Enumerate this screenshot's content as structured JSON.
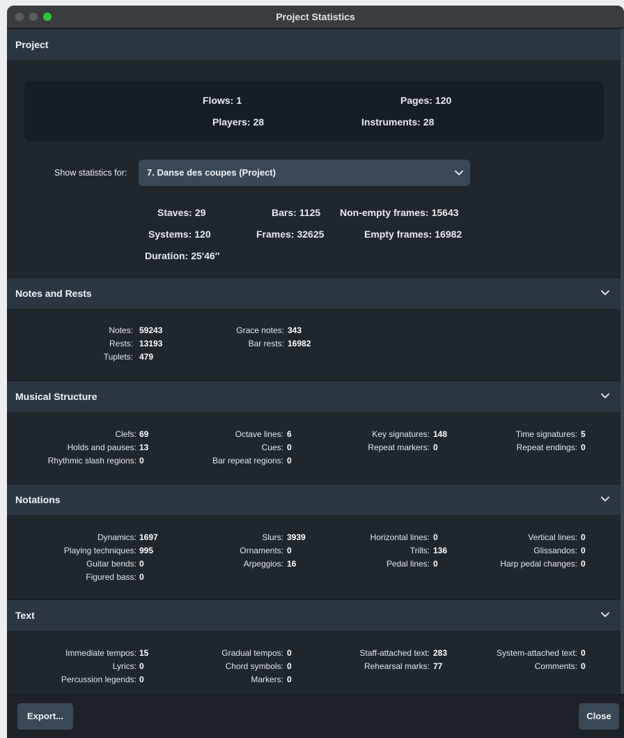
{
  "window": {
    "title": "Project Statistics"
  },
  "project": {
    "header": "Project",
    "summary": {
      "flows": {
        "label": "Flows:",
        "value": "1"
      },
      "pages": {
        "label": "Pages:",
        "value": "120"
      },
      "players": {
        "label": "Players:",
        "value": "28"
      },
      "instruments": {
        "label": "Instruments:",
        "value": "28"
      }
    },
    "show_for_label": "Show statistics for:",
    "selected_flow": "7. Danse des coupes (Project)",
    "stats": {
      "staves": {
        "label": "Staves:",
        "value": "29"
      },
      "bars": {
        "label": "Bars:",
        "value": "1125"
      },
      "nonempty": {
        "label": "Non-empty frames:",
        "value": "15643"
      },
      "systems": {
        "label": "Systems:",
        "value": "120"
      },
      "frames": {
        "label": "Frames:",
        "value": "32625"
      },
      "empty": {
        "label": "Empty frames:",
        "value": "16982"
      },
      "duration": {
        "label": "Duration:",
        "value": "25'46″"
      }
    }
  },
  "notes": {
    "header": "Notes and Rests",
    "items": [
      {
        "label": "Notes:",
        "value": "59243"
      },
      {
        "label": "Rests:",
        "value": "13193"
      },
      {
        "label": "Tuplets:",
        "value": "479"
      },
      {
        "label": "Grace notes:",
        "value": "343"
      },
      {
        "label": "Bar rests:",
        "value": "16982"
      }
    ]
  },
  "structure": {
    "header": "Musical Structure",
    "items": [
      {
        "label": "Clefs:",
        "value": "69"
      },
      {
        "label": "Holds and pauses:",
        "value": "13"
      },
      {
        "label": "Rhythmic slash regions:",
        "value": "0"
      },
      {
        "label": "Octave lines:",
        "value": "6"
      },
      {
        "label": "Cues:",
        "value": "0"
      },
      {
        "label": "Bar repeat regions:",
        "value": "0"
      },
      {
        "label": "Key signatures:",
        "value": "148"
      },
      {
        "label": "Repeat markers:",
        "value": "0"
      },
      {
        "label": "Time signatures:",
        "value": "5"
      },
      {
        "label": "Repeat endings:",
        "value": "0"
      }
    ]
  },
  "notations": {
    "header": "Notations",
    "items": [
      {
        "label": "Dynamics:",
        "value": "1697"
      },
      {
        "label": "Playing techniques:",
        "value": "995"
      },
      {
        "label": "Guitar bends:",
        "value": "0"
      },
      {
        "label": "Figured bass:",
        "value": "0"
      },
      {
        "label": "Slurs:",
        "value": "3939"
      },
      {
        "label": "Ornaments:",
        "value": "0"
      },
      {
        "label": "Arpeggios:",
        "value": "16"
      },
      {
        "label": "Horizontal lines:",
        "value": "0"
      },
      {
        "label": "Trills:",
        "value": "136"
      },
      {
        "label": "Pedal lines:",
        "value": "0"
      },
      {
        "label": "Vertical lines:",
        "value": "0"
      },
      {
        "label": "Glissandos:",
        "value": "0"
      },
      {
        "label": "Harp pedal changes:",
        "value": "0"
      }
    ]
  },
  "text": {
    "header": "Text",
    "items": [
      {
        "label": "Immediate tempos:",
        "value": "15"
      },
      {
        "label": "Lyrics:",
        "value": "0"
      },
      {
        "label": "Percussion legends:",
        "value": "0"
      },
      {
        "label": "Gradual tempos:",
        "value": "0"
      },
      {
        "label": "Chord symbols:",
        "value": "0"
      },
      {
        "label": "Markers:",
        "value": "0"
      },
      {
        "label": "Staff-attached text:",
        "value": "283"
      },
      {
        "label": "Rehearsal marks:",
        "value": "77"
      },
      {
        "label": "System-attached text:",
        "value": "0"
      },
      {
        "label": "Comments:",
        "value": "0"
      }
    ]
  },
  "footer": {
    "export_label": "Export...",
    "close_label": "Close"
  },
  "icons": {
    "chevron": "chevron-down-icon"
  },
  "colors": {
    "accent_green": "#2dc23f",
    "panel": "#1f262c",
    "header": "#2c3641"
  }
}
